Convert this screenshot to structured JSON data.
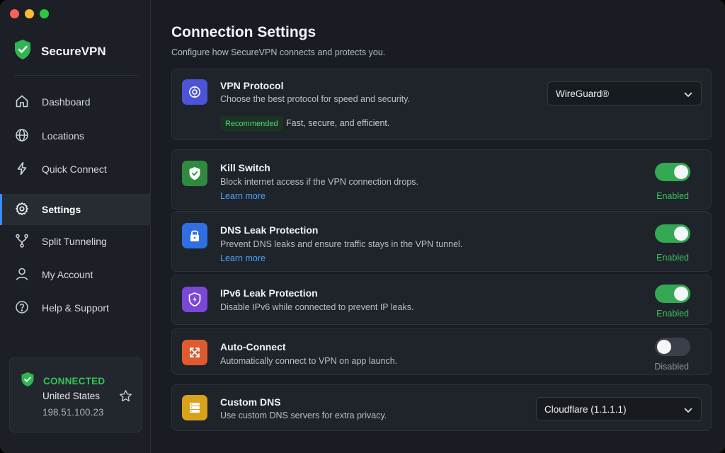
{
  "app": {
    "name": "SecureVPN"
  },
  "nav": {
    "items": [
      {
        "label": "Dashboard"
      },
      {
        "label": "Locations"
      },
      {
        "label": "Quick Connect"
      },
      {
        "label": "Settings"
      },
      {
        "label": "Split Tunneling"
      },
      {
        "label": "My Account"
      },
      {
        "label": "Help & Support"
      }
    ],
    "active": "Settings"
  },
  "status": {
    "label": "CONNECTED",
    "country": "United States",
    "ip": "198.51.100.23"
  },
  "page": {
    "title": "Connection Settings",
    "subtitle": "Configure how SecureVPN connects and protects you."
  },
  "settings": {
    "protocol": {
      "title": "VPN Protocol",
      "desc": "Choose the best protocol for speed and security.",
      "value": "WireGuard®",
      "badge": "Recommended",
      "note": "Fast, secure, and efficient."
    },
    "kill_switch": {
      "title": "Kill Switch",
      "desc": "Block internet access if the VPN connection drops.",
      "link": "Learn more",
      "state": "Enabled"
    },
    "dns_leak": {
      "title": "DNS Leak Protection",
      "desc": "Prevent DNS leaks and ensure traffic stays in the VPN tunnel.",
      "link": "Learn more",
      "state": "Enabled"
    },
    "ipv6_leak": {
      "title": "IPv6 Leak Protection",
      "desc": "Disable IPv6 while connected to prevent IP leaks.",
      "state": "Enabled"
    },
    "auto_connect": {
      "title": "Auto-Connect",
      "desc": "Automatically connect to VPN on app launch.",
      "state": "Disabled"
    },
    "custom_dns": {
      "title": "Custom DNS",
      "desc": "Use custom DNS servers for extra privacy.",
      "value": "Cloudflare (1.1.1.1)"
    }
  },
  "colors": {
    "accent": "#3d8bff",
    "success": "#34a853",
    "link": "#4aa3ff",
    "protocol_tile": "#4b53d6",
    "kill_tile": "#2f8a3f",
    "dns_tile": "#2f6fe3",
    "ipv6_tile": "#7b47d6",
    "auto_tile": "#e05a2f",
    "customdns_tile": "#d9a21c"
  },
  "icons": {
    "brand": "shield-check-icon",
    "dashboard": "home-icon",
    "locations": "globe-icon",
    "quick_connect": "lightning-icon",
    "settings": "gear-icon",
    "split_tunneling": "fork-icon",
    "account": "user-icon",
    "help": "help-circle-icon",
    "status": "shield-check-icon",
    "favorite": "star-icon",
    "protocol": "protocol-icon",
    "kill_switch": "shield-icon",
    "dns_leak": "lock-icon",
    "ipv6_leak": "shield-icon",
    "auto_connect": "arrows-icon",
    "custom_dns": "server-icon",
    "dropdown": "chevron-down-icon"
  }
}
